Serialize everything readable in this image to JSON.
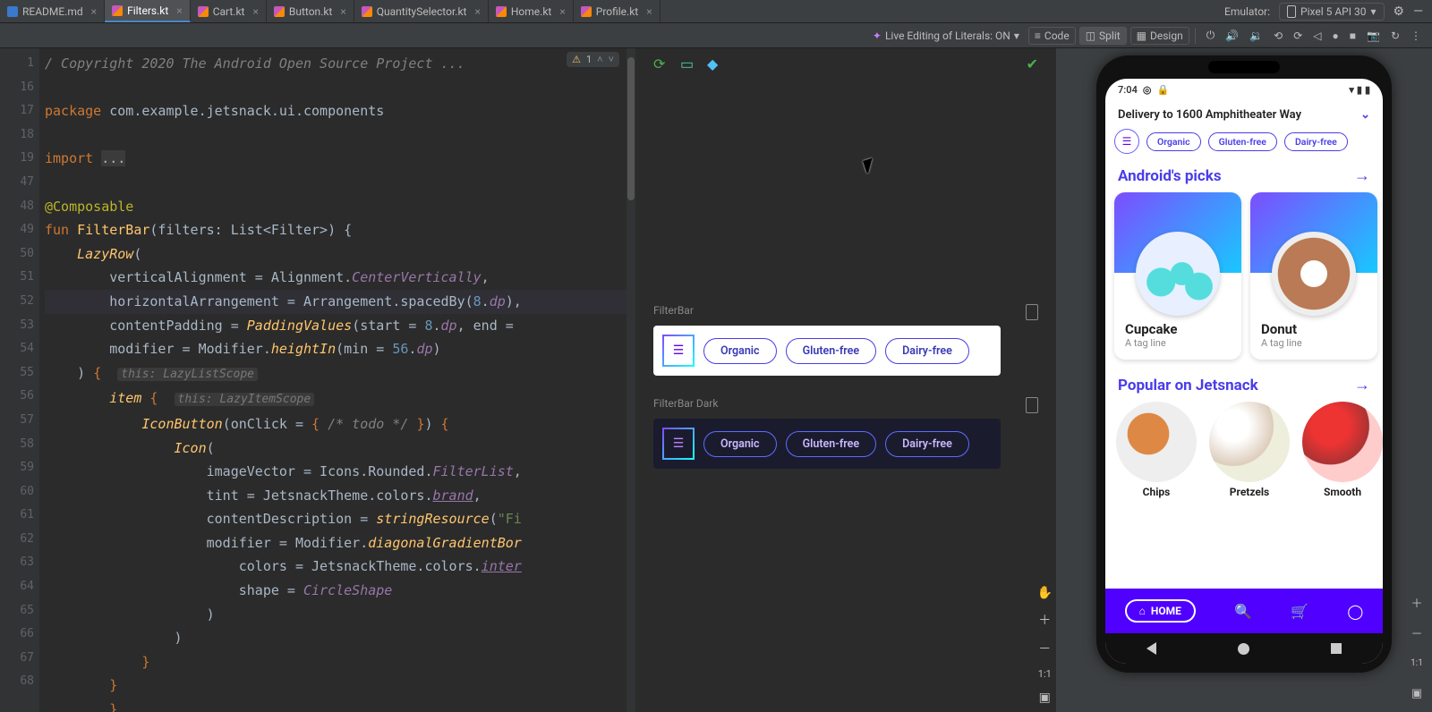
{
  "tabs": [
    {
      "label": "README.md",
      "kind": "md",
      "active": false
    },
    {
      "label": "Filters.kt",
      "kind": "kt",
      "active": true
    },
    {
      "label": "Cart.kt",
      "kind": "kt",
      "active": false
    },
    {
      "label": "Button.kt",
      "kind": "kt",
      "active": false
    },
    {
      "label": "QuantitySelector.kt",
      "kind": "kt",
      "active": false
    },
    {
      "label": "Home.kt",
      "kind": "kt",
      "active": false
    },
    {
      "label": "Profile.kt",
      "kind": "kt",
      "active": false
    }
  ],
  "header": {
    "emulator_label": "Emulator:",
    "device_name": "Pixel 5 API 30"
  },
  "toolbar": {
    "live_edit": "Live Editing of Literals: ON",
    "code": "Code",
    "split": "Split",
    "design": "Design"
  },
  "inspection": {
    "count": "1"
  },
  "gutter_lines": [
    "1",
    "16",
    "17",
    "18",
    "19",
    "47",
    "48",
    "49",
    "50",
    "51",
    "52",
    "53",
    "54",
    "55",
    "56",
    "57",
    "58",
    "59",
    "60",
    "61",
    "62",
    "63",
    "64",
    "65",
    "66",
    "67",
    "68"
  ],
  "previews": {
    "light_label": "FilterBar",
    "dark_label": "FilterBar Dark",
    "chips": [
      "Organic",
      "Gluten-free",
      "Dairy-free"
    ]
  },
  "app": {
    "status_time": "7:04",
    "delivery": "Delivery to 1600 Amphitheater Way",
    "filter_chips": [
      "Organic",
      "Gluten-free",
      "Dairy-free"
    ],
    "section1": "Android's picks",
    "products": [
      {
        "name": "Cupcake",
        "tag": "A tag line"
      },
      {
        "name": "Donut",
        "tag": "A tag line"
      }
    ],
    "section2": "Popular on Jetsnack",
    "snacks": [
      "Chips",
      "Pretzels",
      "Smooth"
    ],
    "home_label": "HOME"
  },
  "zoom": {
    "one_to_one": "1:1"
  }
}
